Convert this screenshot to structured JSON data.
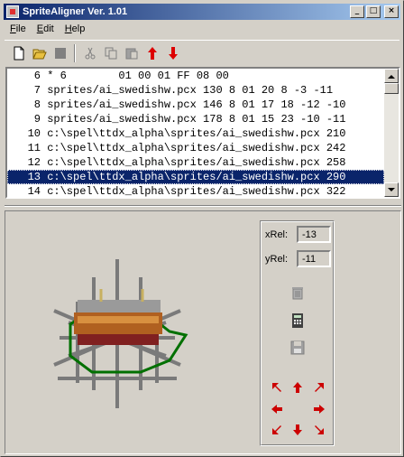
{
  "window": {
    "title": "SpriteAligner Ver. 1.01"
  },
  "titlebar_buttons": {
    "minimize": "_",
    "maximize": "□",
    "close": "×"
  },
  "menu": [
    {
      "key": "F",
      "rest": "ile"
    },
    {
      "key": "E",
      "rest": "dit"
    },
    {
      "key": "H",
      "rest": "elp"
    }
  ],
  "toolbar": {
    "items": [
      "new-file-icon",
      "open-folder-icon",
      "save-icon",
      "cut-icon",
      "copy-icon",
      "paste-icon",
      "move-up-icon",
      "move-down-icon"
    ]
  },
  "list": {
    "rows": [
      "    6 * 6        01 00 01 FF 08 00",
      "    7 sprites/ai_swedishw.pcx 130 8 01 20 8 -3 -11",
      "    8 sprites/ai_swedishw.pcx 146 8 01 17 18 -12 -10",
      "    9 sprites/ai_swedishw.pcx 178 8 01 15 23 -10 -11",
      "   10 c:\\spel\\ttdx_alpha\\sprites/ai_swedishw.pcx 210",
      "   11 c:\\spel\\ttdx_alpha\\sprites/ai_swedishw.pcx 242",
      "   12 c:\\spel\\ttdx_alpha\\sprites/ai_swedishw.pcx 258",
      "   13 c:\\spel\\ttdx_alpha\\sprites/ai_swedishw.pcx 290",
      "   14 c:\\spel\\ttdx_alpha\\sprites/ai_swedishw.pcx 322"
    ],
    "selected_index": 7
  },
  "offsets": {
    "xrel_label": "xRel:",
    "xrel_value": "-13",
    "yrel_label": "yRel:",
    "yrel_value": "-11"
  },
  "panel_icons": [
    "trash-icon",
    "calculator-icon",
    "save-disk-icon"
  ],
  "arrows": [
    "up-left",
    "up",
    "up-right",
    "left",
    "right",
    "down-left",
    "down",
    "down-right"
  ],
  "colors": {
    "selection": "#0a246a",
    "titlebar": "#0a246a",
    "arrow": "#cc0000",
    "hexagon": "#007a00"
  }
}
